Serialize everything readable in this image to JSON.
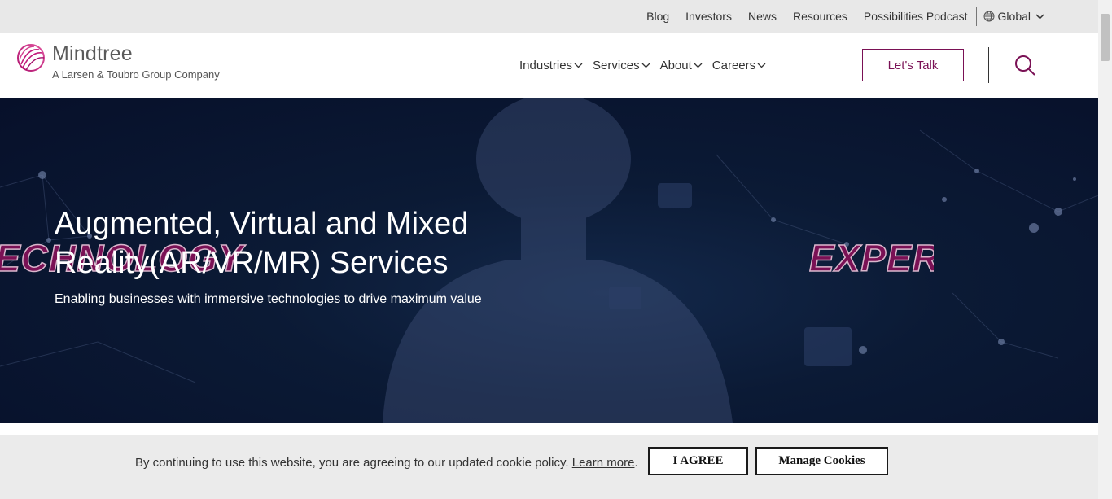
{
  "utility_bar": {
    "links": [
      "Blog",
      "Investors",
      "News",
      "Resources",
      "Possibilities Podcast"
    ],
    "region_label": "Global",
    "icons": [
      "globe-icon",
      "chevron-down-icon"
    ]
  },
  "header": {
    "logo": {
      "name": "Mindtree",
      "tagline": "A Larsen & Toubro Group Company",
      "icon": "mindtree-logo-icon"
    },
    "nav": [
      "Industries",
      "Services",
      "About",
      "Careers"
    ],
    "cta_label": "Let's Talk",
    "search_icon": "search-icon"
  },
  "hero": {
    "title": "Augmented, Virtual and Mixed Reality(AR/VR/MR) Services",
    "subtitle": "Enabling businesses with immersive technologies to drive maximum value",
    "background_words": [
      "ECHNOLOGY",
      "EXPER"
    ]
  },
  "cookie_banner": {
    "text": "By continuing to use this website, you are agreeing to our updated cookie policy.",
    "learn_more": "Learn more",
    "period": ".",
    "agree_label": "I AGREE",
    "manage_label": "Manage Cookies"
  },
  "colors": {
    "brand": "#7a1155",
    "hero_bg": "#0b1a35",
    "utility_bg": "#e8e8e8",
    "cookie_bg": "#ebebeb"
  }
}
